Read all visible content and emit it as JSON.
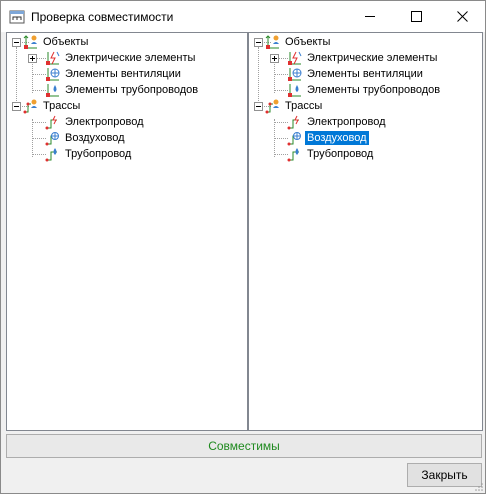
{
  "window": {
    "title": "Проверка совместимости",
    "icons": {
      "app": "compatibility-app-icon",
      "minimize": "minimize-icon",
      "maximize": "maximize-icon",
      "close": "close-icon"
    }
  },
  "left_tree": {
    "objects": "Объекты",
    "electrical_elements": "Электрические элементы",
    "ventilation_elements": "Элементы вентиляции",
    "pipeline_elements": "Элементы трубопроводов",
    "routes": "Трассы",
    "electrical_wire": "Электропровод",
    "air_duct": "Воздуховод",
    "pipeline": "Трубопровод"
  },
  "right_tree": {
    "objects": "Объекты",
    "electrical_elements": "Электрические элементы",
    "ventilation_elements": "Элементы вентиляции",
    "pipeline_elements": "Элементы трубопроводов",
    "routes": "Трассы",
    "electrical_wire": "Электропровод",
    "air_duct": "Воздуховод",
    "pipeline": "Трубопровод",
    "selected": "Воздуховод"
  },
  "status": {
    "text": "Совместимы",
    "color": "#1f8a1f"
  },
  "buttons": {
    "close": "Закрыть"
  },
  "colors": {
    "selection": "#0078d7"
  }
}
